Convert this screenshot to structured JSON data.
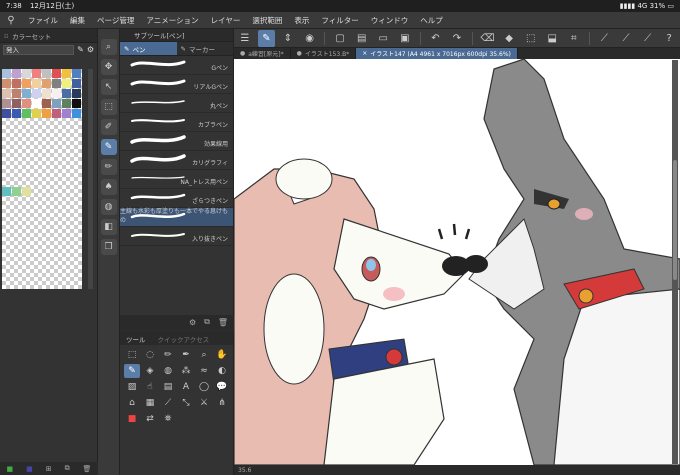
{
  "status_bar": {
    "time": "7:38",
    "date": "12月12日(土)",
    "network": "4G",
    "battery": "31%"
  },
  "menu": [
    "ファイル",
    "編集",
    "ページ管理",
    "アニメーション",
    "レイヤー",
    "選択範囲",
    "表示",
    "フィルター",
    "ウィンドウ",
    "ヘルプ"
  ],
  "color_set": {
    "title": "カラーセット",
    "selected": "発入",
    "colors": [
      "#a8c0e0",
      "#c0a0d0",
      "#d8d8d8",
      "#f08080",
      "#c0c0c0",
      "#e05050",
      "#f0c040",
      "#5080c0",
      "#d09070",
      "#c07060",
      "#f0a060",
      "#f0d0a0",
      "#e0a070",
      "#808080",
      "#f0f080",
      "#4060a0",
      "#e0c0b0",
      "#c08070",
      "#80b0d0",
      "#d0d0f0",
      "#f0e0d0",
      "#f8f0f0",
      "#4a6fa5",
      "#2a3a5a",
      "#b09090",
      "#906060",
      "#e09080",
      "#ffffff",
      "#a06050",
      "#80a0c0",
      "#608060",
      "#101010",
      "#4050a0",
      "#3a5ab0",
      "#60c060",
      "#e0d050",
      "#f0a040",
      "#c06080",
      "#a080d0",
      "#4090e0",
      "#60c0c0",
      "#90d090",
      "#e0e0a0"
    ]
  },
  "subtool": {
    "title": "サブツール[ペン]",
    "tabs": [
      "ペン",
      "マーカー"
    ],
    "brushes": [
      "Gペン",
      "リアルGペン",
      "丸ペン",
      "カブラペン",
      "効果線用",
      "カリグラフィ",
      "NA_トレス用ペン",
      "ざらつきペン",
      "主線も水彩も厚塗りも一本でやる息けもの",
      "入り抜きペン"
    ],
    "selected_index": 8
  },
  "tool_panel": {
    "tabs": [
      "ツール",
      "クイックアクセス"
    ]
  },
  "doc_tabs": [
    "a練習[原元]*",
    "イラスト153.B*",
    "イラスト147 (A4 4961 x 7016px 600dpi 35.6%)"
  ],
  "canvas": {
    "zoom": "35.6"
  }
}
